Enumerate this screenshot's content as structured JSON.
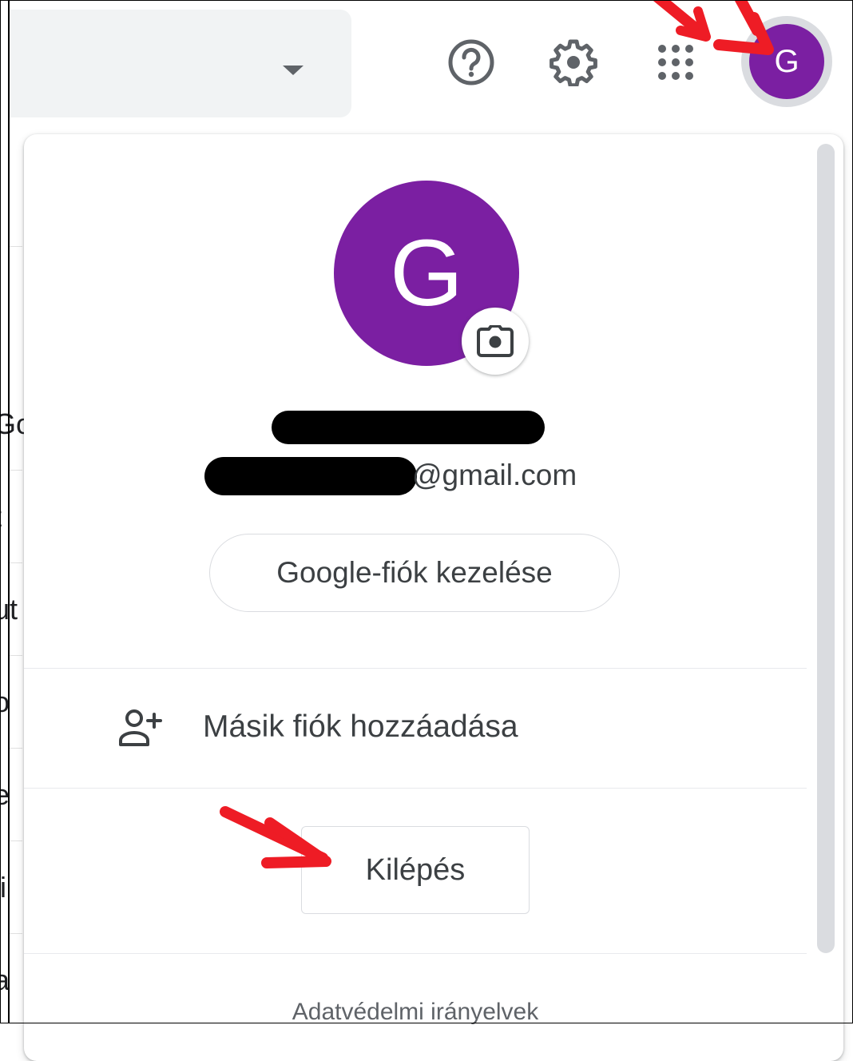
{
  "topbar": {
    "help_icon": "help-circle-icon",
    "settings_icon": "gear-icon",
    "apps_icon": "apps-grid-icon",
    "avatar_initial": "G",
    "avatar_color": "#7b1fa2"
  },
  "background_fragments": [
    "Go",
    "t",
    "ut",
    "o",
    "e",
    "li",
    "a"
  ],
  "account_popup": {
    "avatar_initial": "G",
    "avatar_color": "#7b1fa2",
    "camera_icon": "camera-icon",
    "email_domain": "@gmail.com",
    "manage_account_label": "Google-fiók kezelése",
    "add_account_label": "Másik fiók hozzáadása",
    "add_account_icon": "person-add-icon",
    "sign_out_label": "Kilépés",
    "privacy_link": "Adatvédelmi irányelvek"
  },
  "annotation_color": "#ee1c25"
}
